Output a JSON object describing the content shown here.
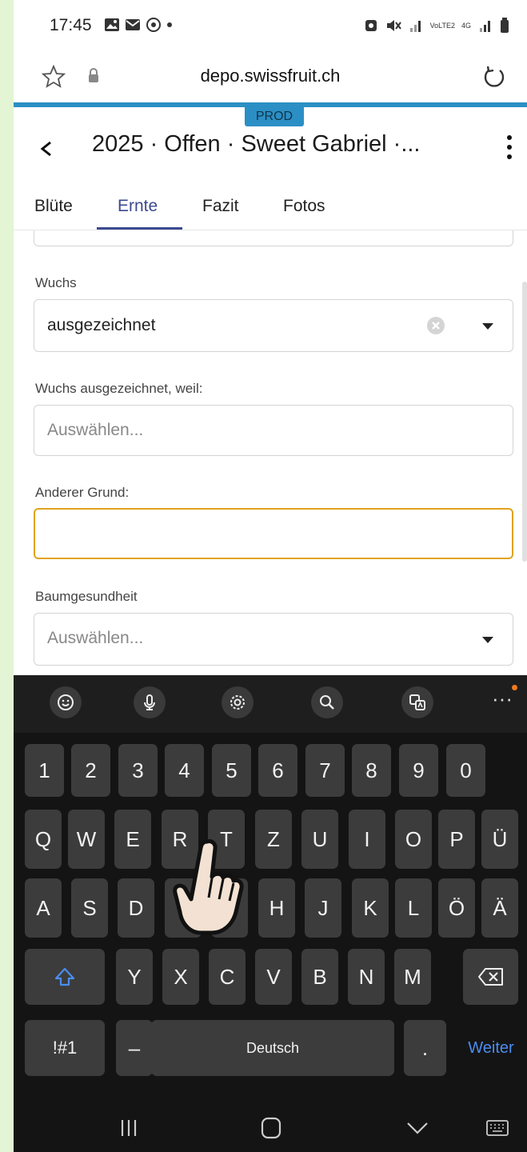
{
  "status": {
    "time": "17:45"
  },
  "browser": {
    "url": "depo.swissfruit.ch",
    "env_badge": "PROD"
  },
  "app": {
    "title": "2025 · Offen · Sweet Gabriel ·..."
  },
  "tabs": [
    {
      "label": "Blüte",
      "active": false
    },
    {
      "label": "Ernte",
      "active": true
    },
    {
      "label": "Fazit",
      "active": false
    },
    {
      "label": "Fotos",
      "active": false
    }
  ],
  "form": {
    "wuchs_label": "Wuchs",
    "wuchs_value": "ausgezeichnet",
    "wuchs_reason_label": "Wuchs ausgezeichnet, weil:",
    "wuchs_reason_placeholder": "Auswählen...",
    "other_reason_label": "Anderer Grund:",
    "other_reason_value": "",
    "tree_health_label": "Baumgesundheit",
    "tree_health_placeholder": "Auswählen..."
  },
  "keyboard": {
    "row_numbers": [
      "1",
      "2",
      "3",
      "4",
      "5",
      "6",
      "7",
      "8",
      "9",
      "0"
    ],
    "row_q": [
      "Q",
      "W",
      "E",
      "R",
      "T",
      "Z",
      "U",
      "I",
      "O",
      "P",
      "Ü"
    ],
    "row_a": [
      "A",
      "S",
      "D",
      "F",
      "G",
      "H",
      "J",
      "K",
      "L",
      "Ö",
      "Ä"
    ],
    "row_y": [
      "Y",
      "X",
      "C",
      "V",
      "B",
      "N",
      "M"
    ],
    "symbols_label": "!#1",
    "dash_label": "–",
    "space_label": "Deutsch",
    "period_label": ".",
    "action_label": "Weiter"
  },
  "colors": {
    "accent_tab": "#3b4a8f",
    "prod_badge": "#2b8fc5",
    "focus_border": "#e0a31c",
    "keyboard_action": "#4b8df0"
  }
}
